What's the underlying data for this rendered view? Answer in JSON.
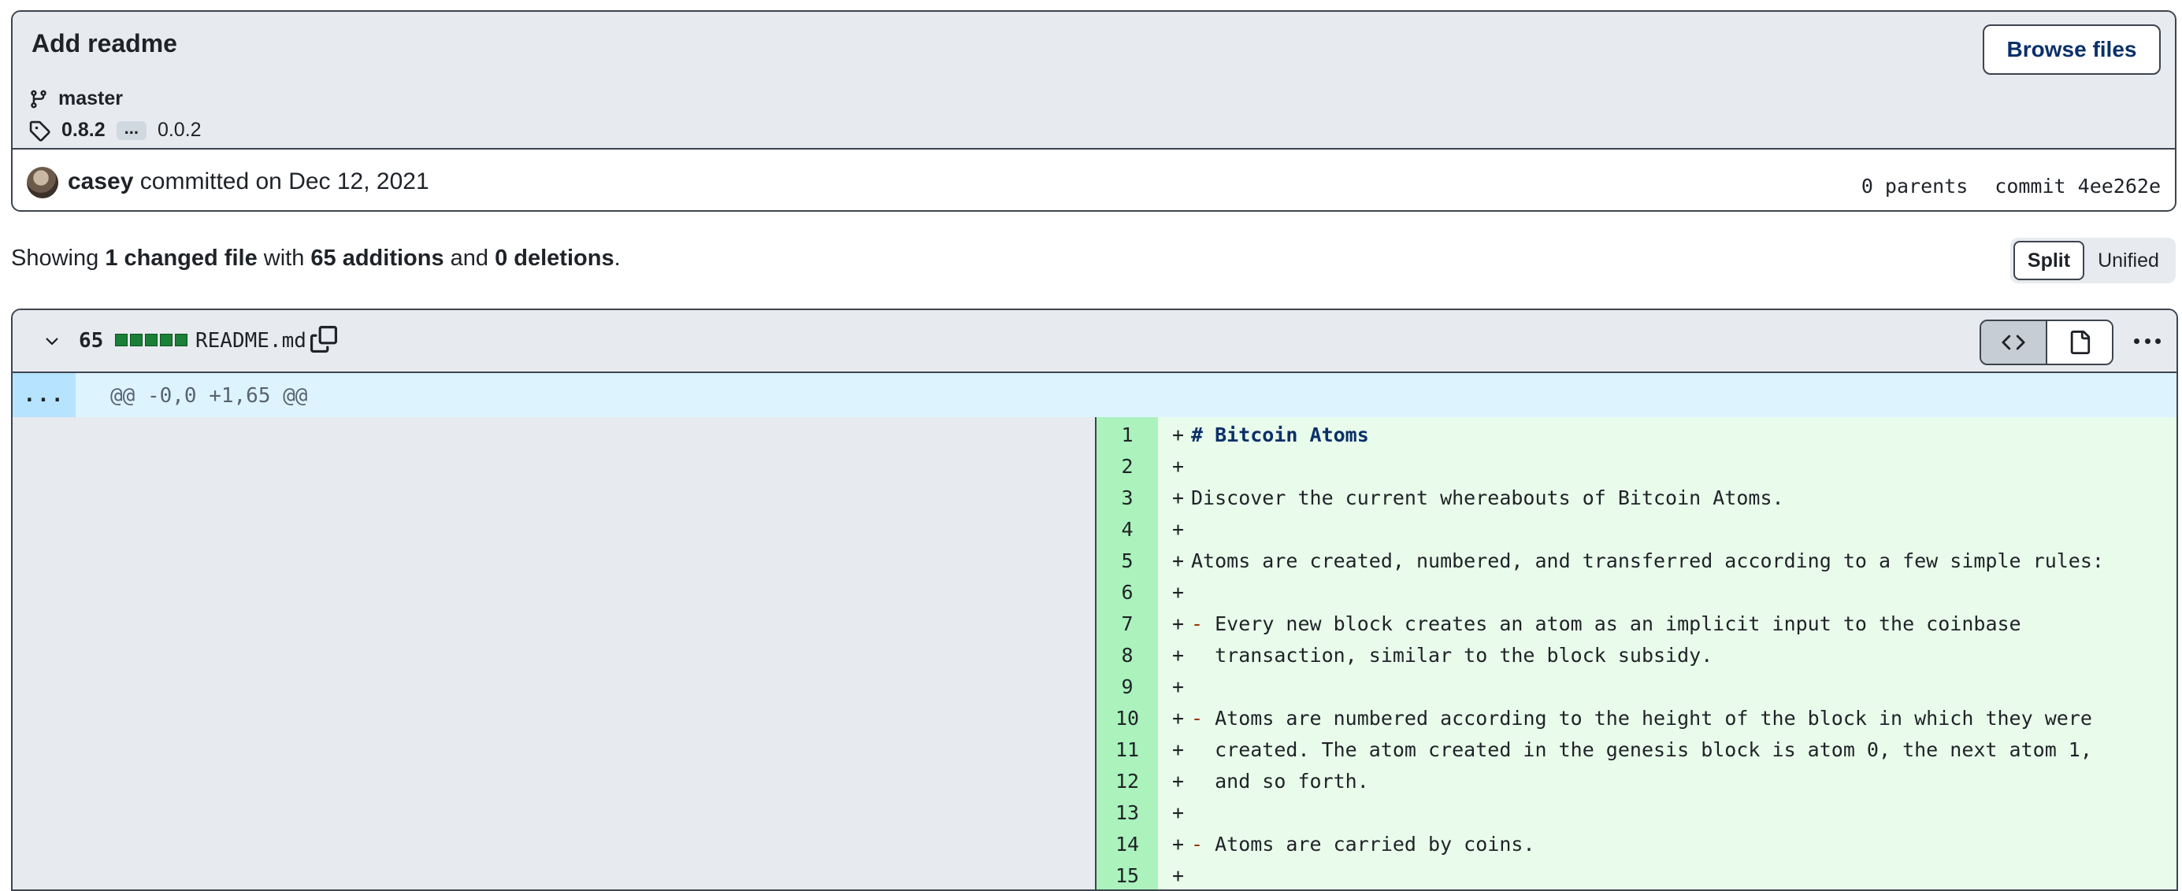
{
  "commit": {
    "title": "Add readme",
    "browse_label": "Browse files",
    "branch": "master",
    "tag_latest": "0.8.2",
    "tag_ellipsis": "...",
    "tag_oldest": "0.0.2",
    "author": "casey",
    "committed_text": "committed on Dec 12, 2021",
    "parents": "0 parents",
    "commit_label": "commit 4ee262e"
  },
  "summary": {
    "prefix": "Showing ",
    "changed": "1 changed file",
    "with": " with ",
    "additions": "65 additions",
    "and": " and ",
    "deletions": "0 deletions",
    "suffix": "."
  },
  "view_toggle": {
    "split": "Split",
    "unified": "Unified",
    "active": "Split"
  },
  "file": {
    "change_count": "65",
    "name": "README.md",
    "hunk_expand": "...",
    "hunk_header": "@@ -0,0 +1,65 @@"
  },
  "diff_lines": [
    {
      "n": "1",
      "sign": "+",
      "text": "# Bitcoin Atoms",
      "kind": "heading"
    },
    {
      "n": "2",
      "sign": "+",
      "text": "",
      "kind": "text"
    },
    {
      "n": "3",
      "sign": "+",
      "text": "Discover the current whereabouts of Bitcoin Atoms.",
      "kind": "text"
    },
    {
      "n": "4",
      "sign": "+",
      "text": "",
      "kind": "text"
    },
    {
      "n": "5",
      "sign": "+",
      "text": "Atoms are created, numbered, and transferred according to a few simple rules:",
      "kind": "text"
    },
    {
      "n": "6",
      "sign": "+",
      "text": "",
      "kind": "text"
    },
    {
      "n": "7",
      "sign": "+",
      "bullet": "- ",
      "text": "Every new block creates an atom as an implicit input to the coinbase",
      "kind": "bullet"
    },
    {
      "n": "8",
      "sign": "+",
      "text": "  transaction, similar to the block subsidy.",
      "kind": "text"
    },
    {
      "n": "9",
      "sign": "+",
      "text": "",
      "kind": "text"
    },
    {
      "n": "10",
      "sign": "+",
      "bullet": "- ",
      "text": "Atoms are numbered according to the height of the block in which they were",
      "kind": "bullet"
    },
    {
      "n": "11",
      "sign": "+",
      "text": "  created. The atom created in the genesis block is atom 0, the next atom 1,",
      "kind": "text"
    },
    {
      "n": "12",
      "sign": "+",
      "text": "  and so forth.",
      "kind": "text"
    },
    {
      "n": "13",
      "sign": "+",
      "text": "",
      "kind": "text"
    },
    {
      "n": "14",
      "sign": "+",
      "bullet": "- ",
      "text": "Atoms are carried by coins.",
      "kind": "bullet"
    },
    {
      "n": "15",
      "sign": "+",
      "text": "",
      "kind": "text"
    }
  ],
  "icons": {
    "branch": "git-branch-icon",
    "tag": "tag-icon",
    "chevron": "chevron-down-icon",
    "copy": "copy-icon",
    "code_view": "code-icon",
    "file_view": "file-icon",
    "more": "kebab-horizontal-icon"
  },
  "colors": {
    "addition_bg": "#e9fbea",
    "addition_gutter": "#abf2bc",
    "hunk_bg": "#ddf4ff",
    "diffstat_green": "#1a7f37",
    "link_blue": "#0a3069"
  }
}
